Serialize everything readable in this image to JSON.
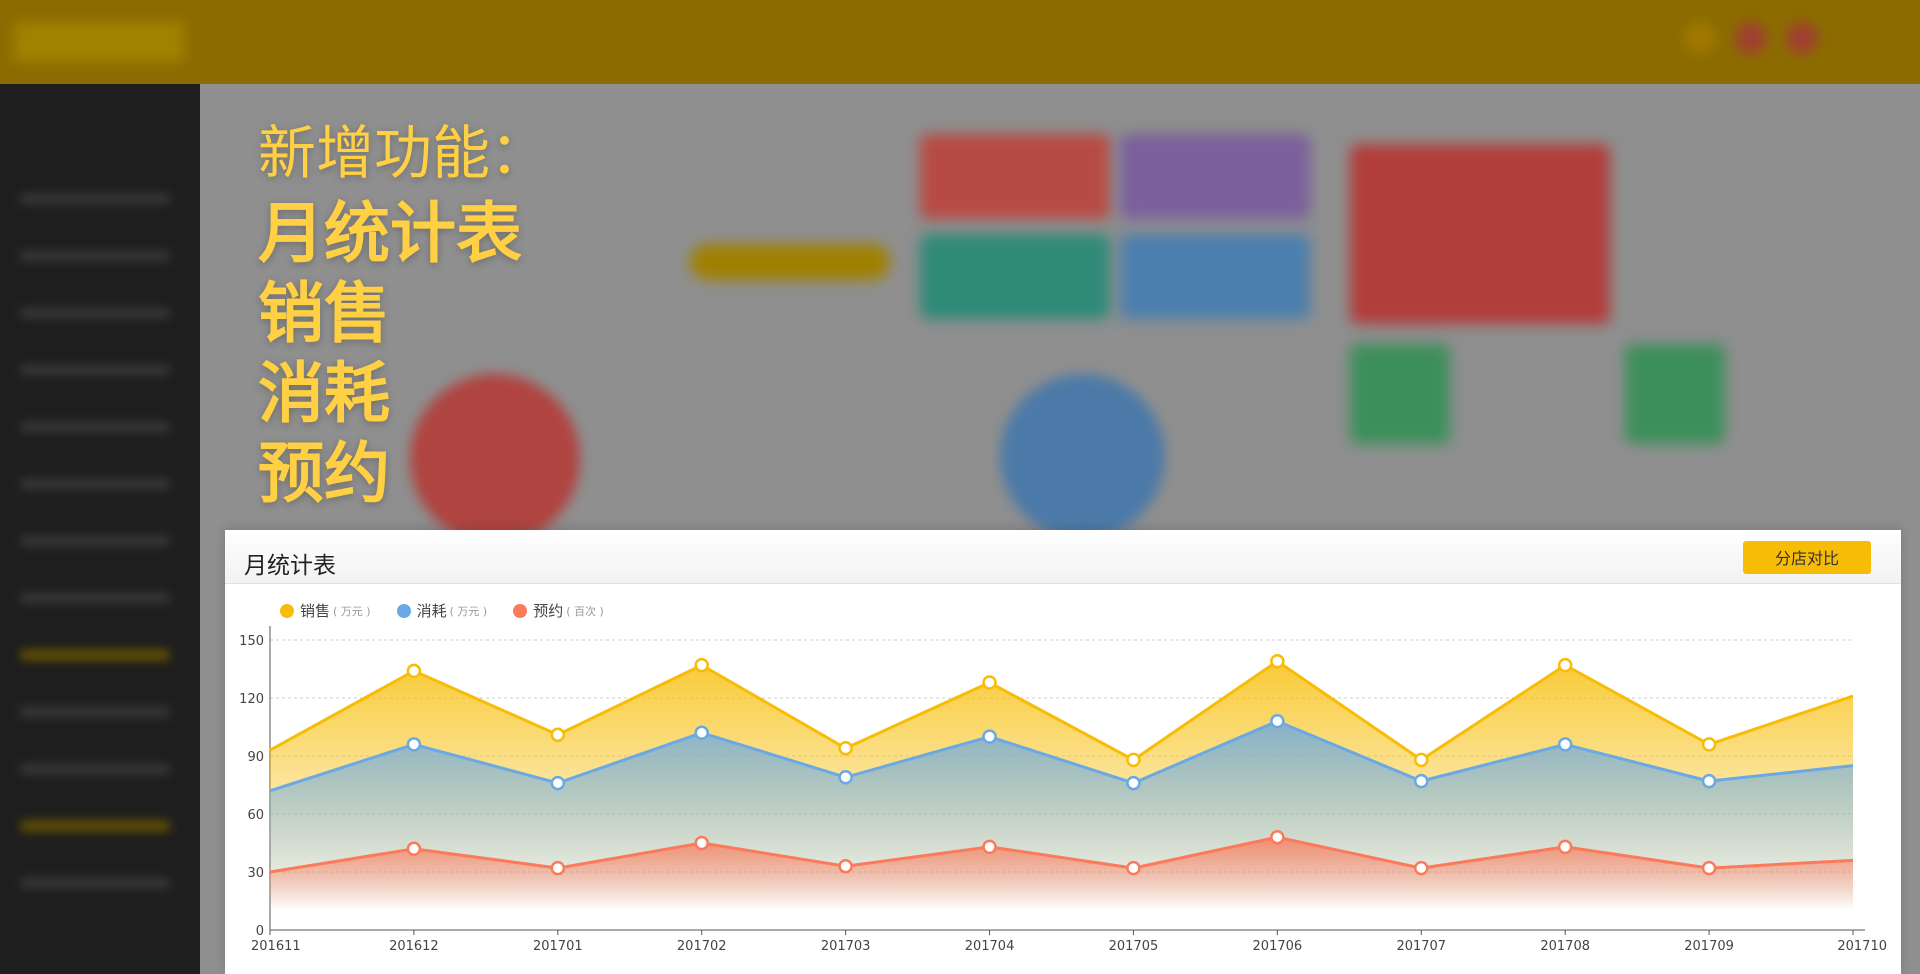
{
  "headline": {
    "intro": "新增功能：",
    "items": [
      "月统计表",
      "销售",
      "消耗",
      "预约"
    ]
  },
  "panel": {
    "title": "月统计表",
    "compare_button": "分店对比"
  },
  "colors": {
    "accent": "#f7bd06",
    "headline": "#ffd043",
    "sales": "#f7bd06",
    "consumption": "#6aa9e3",
    "booking": "#fb7a5a"
  },
  "chart_data": {
    "type": "area",
    "categories": [
      "201611",
      "201612",
      "201701",
      "201702",
      "201703",
      "201704",
      "201705",
      "201706",
      "201707",
      "201708",
      "201709",
      "201710"
    ],
    "ylim": [
      0,
      150
    ],
    "yticks": [
      0,
      30,
      60,
      90,
      120,
      150
    ],
    "grid": true,
    "legend_position": "top-left",
    "series": [
      {
        "name": "销售",
        "unit": "( 万元 )",
        "color": "#f7bd06",
        "values": [
          93,
          134,
          101,
          137,
          94,
          128,
          88,
          139,
          88,
          137,
          96,
          121
        ]
      },
      {
        "name": "消耗",
        "unit": "( 万元 )",
        "color": "#6aa9e3",
        "values": [
          72,
          96,
          76,
          102,
          79,
          100,
          76,
          108,
          77,
          96,
          77,
          85
        ]
      },
      {
        "name": "预约",
        "unit": "( 百次 )",
        "color": "#fb7a5a",
        "values": [
          30,
          42,
          32,
          45,
          33,
          43,
          32,
          48,
          32,
          43,
          32,
          36
        ]
      }
    ]
  }
}
